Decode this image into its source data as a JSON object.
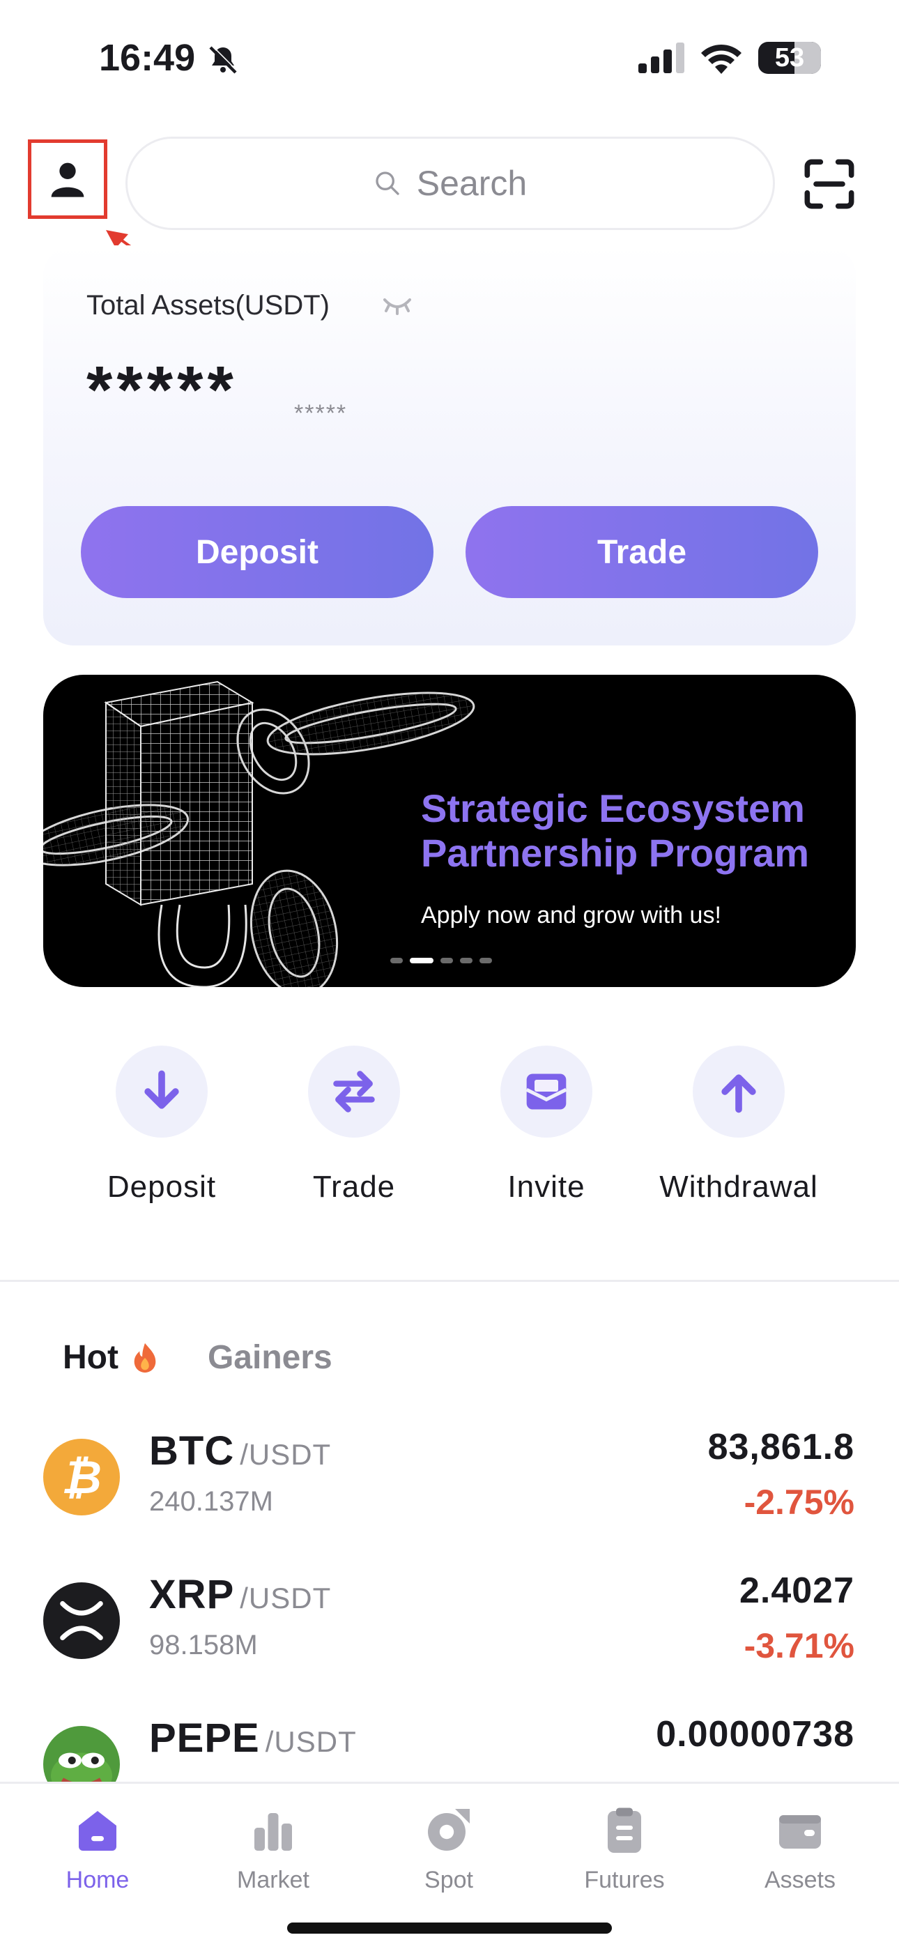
{
  "status_bar": {
    "time": "16:49",
    "battery": "53",
    "icons": [
      "bell-off-icon",
      "signal-icon",
      "wifi-icon",
      "battery-icon"
    ]
  },
  "header": {
    "profile_icon": "person-icon",
    "search_placeholder": "Search",
    "scan_icon": "scan-icon"
  },
  "assets": {
    "title": "Total Assets(USDT)",
    "value": "*****",
    "sub_value": "*****",
    "deposit_label": "Deposit",
    "trade_label": "Trade"
  },
  "banner": {
    "title_line1": "Strategic Ecosystem",
    "title_line2": "Partnership Program",
    "subtitle": "Apply now and grow with us!",
    "slide_count": 5,
    "active_slide": 2
  },
  "quick_actions": [
    {
      "label": "Deposit",
      "icon": "arrow-down-icon"
    },
    {
      "label": "Trade",
      "icon": "swap-icon"
    },
    {
      "label": "Invite",
      "icon": "envelope-icon"
    },
    {
      "label": "Withdrawal",
      "icon": "arrow-up-icon"
    }
  ],
  "market_tabs": {
    "hot": "Hot",
    "gainers": "Gainers"
  },
  "market": [
    {
      "symbol": "BTC",
      "quote": "/USDT",
      "volume": "240.137M",
      "price": "83,861.8",
      "change": "-2.75%"
    },
    {
      "symbol": "XRP",
      "quote": "/USDT",
      "volume": "98.158M",
      "price": "2.4027",
      "change": "-3.71%"
    },
    {
      "symbol": "PEPE",
      "quote": "/USDT",
      "volume": "",
      "price": "0.00000738",
      "change": ""
    }
  ],
  "tab_bar": [
    {
      "label": "Home",
      "icon": "home-icon",
      "active": true
    },
    {
      "label": "Market",
      "icon": "bar-chart-icon"
    },
    {
      "label": "Spot",
      "icon": "spot-icon"
    },
    {
      "label": "Futures",
      "icon": "clipboard-icon"
    },
    {
      "label": "Assets",
      "icon": "wallet-icon"
    }
  ],
  "colors": {
    "accent": "#7c62ea",
    "negative": "#e0553e",
    "annotation": "#e23b2f"
  }
}
